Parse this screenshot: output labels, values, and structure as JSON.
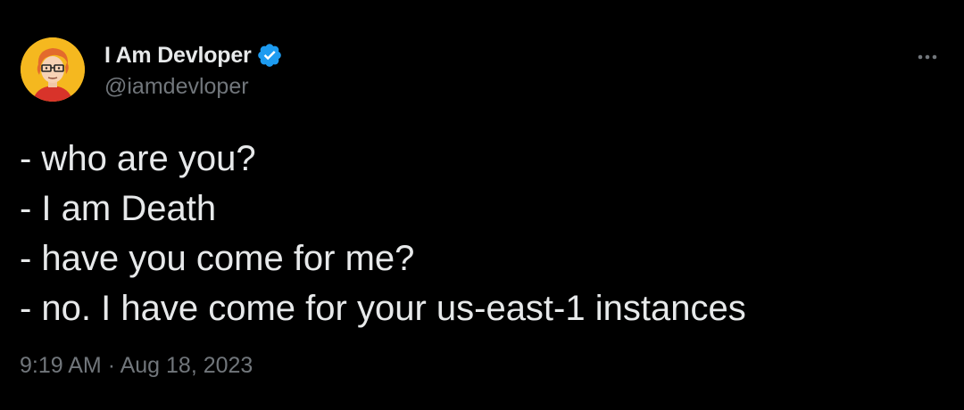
{
  "author": {
    "display_name": "I Am Devloper",
    "handle": "@iamdevloper",
    "verified": true,
    "verified_icon": "verified-badge-icon",
    "avatar_icon": "cartoon-developer-avatar"
  },
  "menu": {
    "icon": "more-horizontal-icon"
  },
  "tweet": {
    "lines": [
      "- who are you?",
      "- I am Death",
      "- have you come for me?",
      "- no. I have come for your us-east-1 instances"
    ],
    "time": "9:19 AM",
    "separator": "·",
    "date": "Aug 18, 2023"
  },
  "colors": {
    "background": "#000000",
    "text_primary": "#e7e9ea",
    "text_secondary": "#71767b",
    "verified_blue": "#1d9bf0"
  }
}
